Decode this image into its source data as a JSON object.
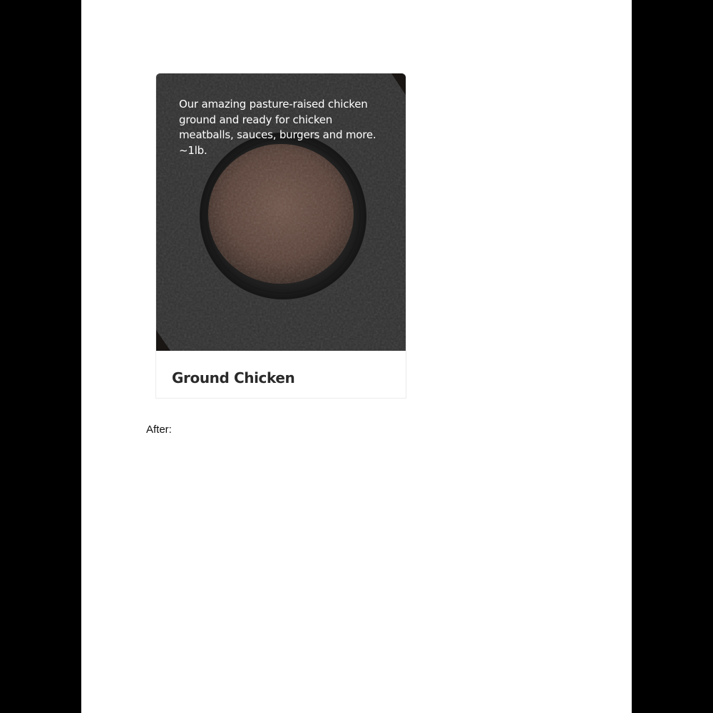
{
  "card": {
    "description": "Our amazing pasture-raised chicken\nground and ready for chicken\nmeatballs, sauces, burgers and more.\n~1lb.",
    "title": "Ground Chicken",
    "image_alt": "ground-chicken-in-glass-bowl"
  },
  "caption": "After:",
  "colors": {
    "overlay": "#1c1b1a",
    "paper": "#3e3e3e",
    "meat": "#7a5a4c",
    "title": "#2a2a2a"
  }
}
